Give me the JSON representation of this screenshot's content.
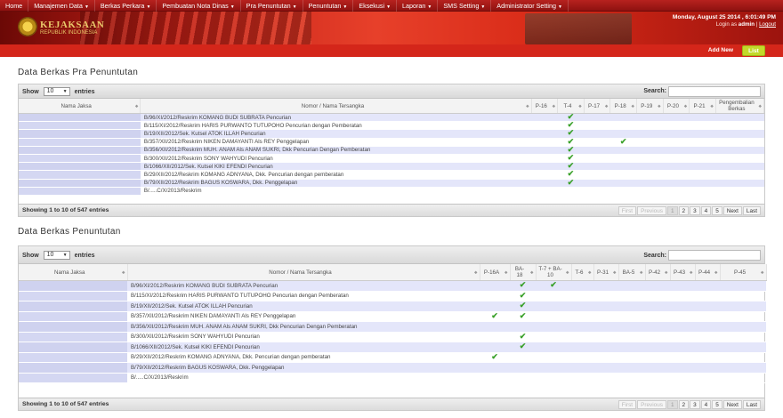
{
  "nav": {
    "items": [
      "Home",
      "Manajemen Data",
      "Berkas Perkara",
      "Pembuatan Nota Dinas",
      "Pra Penuntutan",
      "Penuntutan",
      "Eksekusi",
      "Laporan",
      "SMS Setting",
      "Administrator Setting"
    ],
    "has_caret": [
      false,
      true,
      true,
      true,
      true,
      true,
      true,
      true,
      true,
      true
    ]
  },
  "header": {
    "logo_text": "KEJAKSAAN",
    "logo_sub": "REPUBLIK INDONESIA",
    "datetime": "Monday, August 25 2014 , 6:01:49 PM",
    "login_prefix": "Login as ",
    "login_user": "admin",
    "logout": "Logout"
  },
  "actions": {
    "add_new": "Add New",
    "list": "List"
  },
  "colors": {
    "nav_bg": "#a11b18",
    "action_bar": "#d4261a",
    "list_button": "#c3d92a",
    "row_highlight": "#e4e6fa",
    "check": "#3aa12a"
  },
  "rows": [
    "B/96/XI/2012/Reskrim KOMANG BUDI SUBRATA Pencurian",
    "B/115/XI/2012/Reskrim HARIS PURWANTO TUTUPOHO Pencurian dengan Pemberatan",
    "B/19/XII/2012/Sek. Kutsel ATOK ILLAH Pencurian",
    "B/357/XII/2012/Reskrim NIKEN DAMAYANTI Als REY Penggelapan",
    "B/356/XII/2012/Reskrim MUH. ANAM Als ANAM SUKRI, Dkk Pencurian Dengan Pemberatan",
    "B/300/XII/2012/Reskrim SONY WAHYUDI Pencurian",
    "B/1066/XII/2012/Sek. Kutsel KIKI EFENDI Pencurian",
    "B/29/XII/2012/Reskrim KOMANG ADNYANA, Dkk. Pencurian dengan pemberatan",
    "B/79/XII/2012/Reskrim BAGUS KOSWARA, Dkk. Penggelapan",
    "B/.....C/X/2013/Reskrim"
  ],
  "common": {
    "show": "Show",
    "entries": "entries",
    "page_size": "10",
    "search": "Search:",
    "showing": "Showing 1 to 10 of 547 entries",
    "pager": [
      "First",
      "Previous",
      "1",
      "2",
      "3",
      "4",
      "5",
      "Next",
      "Last"
    ]
  },
  "pra": {
    "title": "Data Berkas Pra Penuntutan",
    "col_jaksa": "Nama Jaksa",
    "col_nomor": "Nomor / Nama Tersangka",
    "cols": [
      "P-16",
      "T-4",
      "P-17",
      "P-18",
      "P-19",
      "P-20",
      "P-21",
      "Pengembalian Berkas"
    ],
    "checks": [
      [
        false,
        true,
        false,
        false,
        false,
        false,
        false,
        false
      ],
      [
        false,
        true,
        false,
        false,
        false,
        false,
        false,
        false
      ],
      [
        false,
        true,
        false,
        false,
        false,
        false,
        false,
        false
      ],
      [
        false,
        true,
        false,
        true,
        false,
        false,
        false,
        false
      ],
      [
        false,
        true,
        false,
        false,
        false,
        false,
        false,
        false
      ],
      [
        false,
        true,
        false,
        false,
        false,
        false,
        false,
        false
      ],
      [
        false,
        true,
        false,
        false,
        false,
        false,
        false,
        false
      ],
      [
        false,
        true,
        false,
        false,
        false,
        false,
        false,
        false
      ],
      [
        false,
        true,
        false,
        false,
        false,
        false,
        false,
        false
      ],
      [
        false,
        false,
        false,
        false,
        false,
        false,
        false,
        false
      ]
    ]
  },
  "penuntutan": {
    "title": "Data Berkas Penuntutan",
    "col_jaksa": "Nama Jaksa",
    "col_nomor": "Nomor / Nama Tersangka",
    "cols": [
      "P-16A",
      "BA-18",
      "T-7 + BA-10",
      "T-6",
      "P-31",
      "BA-5",
      "P-42",
      "P-43",
      "P-44",
      "P-45"
    ],
    "checks": [
      [
        false,
        true,
        true,
        false,
        false,
        false,
        false,
        false,
        false,
        false
      ],
      [
        false,
        true,
        false,
        false,
        false,
        false,
        false,
        false,
        false,
        false
      ],
      [
        false,
        true,
        false,
        false,
        false,
        false,
        false,
        false,
        false,
        false
      ],
      [
        true,
        true,
        false,
        false,
        false,
        false,
        false,
        false,
        false,
        false
      ],
      [
        false,
        false,
        false,
        false,
        false,
        false,
        false,
        false,
        false,
        false
      ],
      [
        false,
        true,
        false,
        false,
        false,
        false,
        false,
        false,
        false,
        false
      ],
      [
        false,
        true,
        false,
        false,
        false,
        false,
        false,
        false,
        false,
        false
      ],
      [
        true,
        false,
        false,
        false,
        false,
        false,
        false,
        false,
        false,
        false
      ],
      [
        false,
        false,
        false,
        false,
        false,
        false,
        false,
        false,
        false,
        false
      ],
      [
        false,
        false,
        false,
        false,
        false,
        false,
        false,
        false,
        false,
        false
      ]
    ]
  }
}
